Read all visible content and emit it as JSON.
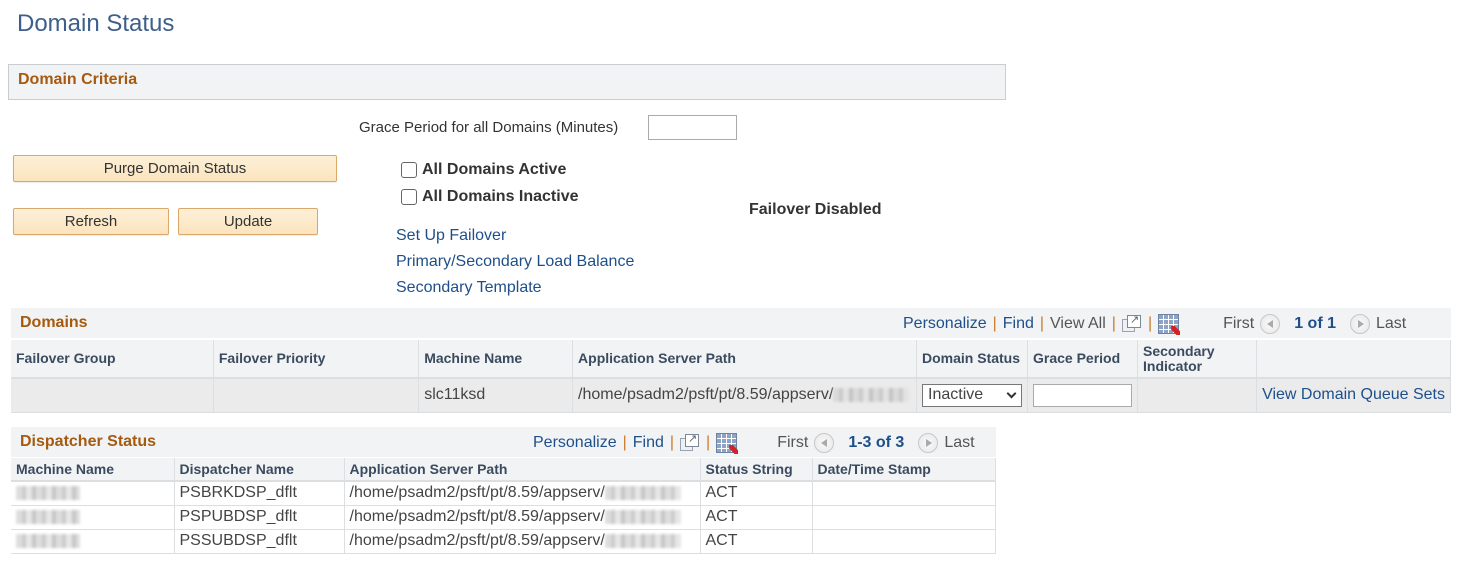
{
  "page": {
    "title": "Domain Status"
  },
  "criteria": {
    "section_title": "Domain Criteria",
    "grace_period_label": "Grace Period for all Domains (Minutes)",
    "grace_period_value": "",
    "purge_button": "Purge Domain Status",
    "refresh_button": "Refresh",
    "update_button": "Update",
    "all_active_label": "All Domains Active",
    "all_active_checked": false,
    "all_inactive_label": "All Domains Inactive",
    "all_inactive_checked": false,
    "failover_status": "Failover Disabled",
    "links": {
      "setup_failover": "Set Up Failover",
      "load_balance": "Primary/Secondary Load Balance",
      "secondary_template": "Secondary Template"
    }
  },
  "grid_tools": {
    "personalize": "Personalize",
    "find": "Find",
    "view_all": "View All",
    "first": "First",
    "last": "Last",
    "separator": "|",
    "icons": [
      "zoom-grid-icon",
      "download-to-excel-icon",
      "previous-icon",
      "next-icon"
    ]
  },
  "domains": {
    "title": "Domains",
    "pagination": "1 of 1",
    "columns": [
      "Failover Group",
      "Failover Priority",
      "Machine Name",
      "Application Server Path",
      "Domain Status",
      "Grace Period",
      "Secondary Indicator",
      ""
    ],
    "rows": [
      {
        "failover_group": "",
        "failover_priority": "",
        "machine_name": "slc11ksd",
        "app_server_path": "/home/psadm2/psft/pt/8.59/appserv/",
        "domain_status": "Inactive",
        "grace_period": "",
        "secondary_indicator": "",
        "action_link": "View Domain Queue Sets"
      }
    ]
  },
  "dispatcher": {
    "title": "Dispatcher Status",
    "pagination": "1-3 of 3",
    "columns": [
      "Machine Name",
      "Dispatcher Name",
      "Application Server Path",
      "Status String",
      "Date/Time Stamp"
    ],
    "rows": [
      {
        "machine_name": "",
        "dispatcher_name": "PSBRKDSP_dflt",
        "app_server_path": "/home/psadm2/psft/pt/8.59/appserv/",
        "status": "ACT",
        "timestamp": ""
      },
      {
        "machine_name": "",
        "dispatcher_name": "PSPUBDSP_dflt",
        "app_server_path": "/home/psadm2/psft/pt/8.59/appserv/",
        "status": "ACT",
        "timestamp": ""
      },
      {
        "machine_name": "",
        "dispatcher_name": "PSSUBDSP_dflt",
        "app_server_path": "/home/psadm2/psft/pt/8.59/appserv/",
        "status": "ACT",
        "timestamp": ""
      }
    ]
  },
  "colors": {
    "title_blue": "#3e5f8a",
    "section_orange": "#a55a10",
    "link_blue": "#1f4f8a",
    "header_bg": "#f1f3f4",
    "button_bg": "#fbe4bd",
    "button_border": "#d9a86a"
  }
}
